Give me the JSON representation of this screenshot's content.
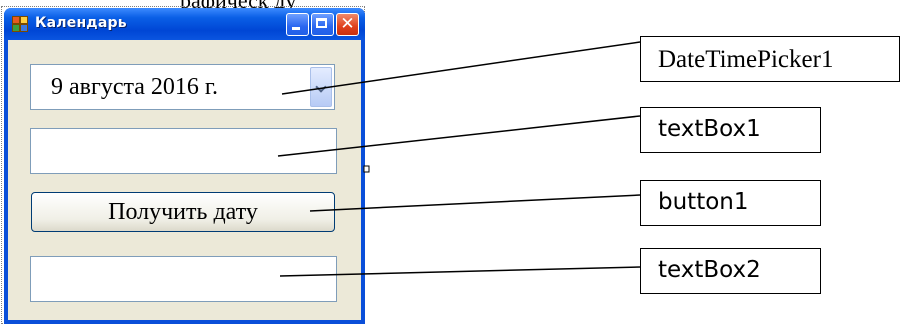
{
  "page": {
    "top_text_fragment": "рафическ   ду"
  },
  "window": {
    "title": "Календарь",
    "minimize_label": "",
    "maximize_label": "",
    "close_label": "✕"
  },
  "form": {
    "date_picker_value": "9  августа  2016 г.",
    "textbox1_value": "",
    "button_label": "Получить дату",
    "textbox2_value": ""
  },
  "callouts": [
    {
      "label": "DateTimePicker1"
    },
    {
      "label": "textBox1"
    },
    {
      "label": "button1"
    },
    {
      "label": "textBox2"
    }
  ],
  "colors": {
    "titlebar": "#0a5fe6",
    "client_background": "#ece9d8",
    "input_border": "#7f9db9",
    "button_border": "#003c74"
  }
}
